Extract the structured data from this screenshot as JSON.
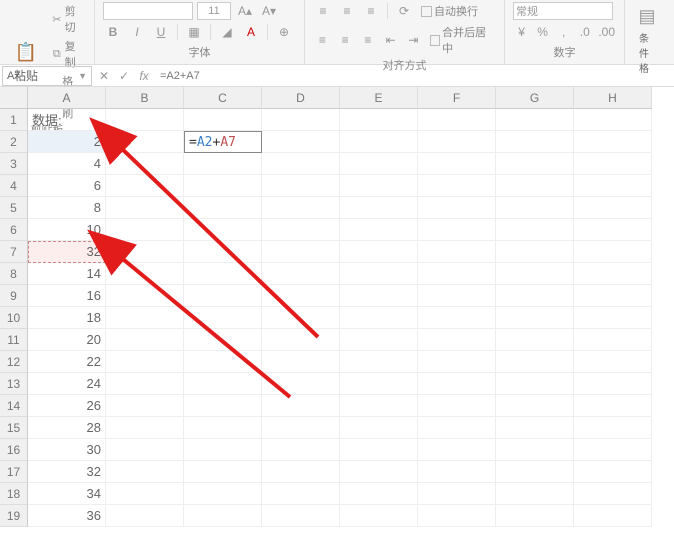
{
  "ribbon": {
    "clipboard": {
      "paste": "粘贴",
      "cut": "剪切",
      "copy": "复制",
      "format_painter": "格式刷",
      "label": "剪贴板"
    },
    "font": {
      "name": "",
      "size": "11",
      "bold": "B",
      "italic": "I",
      "underline": "U",
      "label": "字体"
    },
    "align": {
      "wrap": "自动换行",
      "merge": "合并后居中",
      "label": "对齐方式"
    },
    "number": {
      "general": "常规",
      "label": "数字"
    },
    "styles": {
      "cond": "条件格"
    }
  },
  "formula_bar": {
    "name_box": "A7",
    "formula": "=A2+A7"
  },
  "columns": [
    "A",
    "B",
    "C",
    "D",
    "E",
    "F",
    "G",
    "H"
  ],
  "rows": [
    "1",
    "2",
    "3",
    "4",
    "5",
    "6",
    "7",
    "8",
    "9",
    "10",
    "11",
    "12",
    "13",
    "14",
    "15",
    "16",
    "17",
    "18",
    "19"
  ],
  "sheet": {
    "A1": "数据:",
    "A2": "2",
    "A3": "4",
    "A4": "6",
    "A5": "8",
    "A6": "10",
    "A7": "32",
    "A8": "14",
    "A9": "16",
    "A10": "18",
    "A11": "20",
    "A12": "22",
    "A13": "24",
    "A14": "26",
    "A15": "28",
    "A16": "30",
    "A17": "32",
    "A18": "34",
    "A19": "36",
    "C2_formula_eq": "=",
    "C2_formula_r1": "A2",
    "C2_formula_plus": "+",
    "C2_formula_r2": "A7"
  },
  "chart_data": {
    "type": "table",
    "title": "数据:",
    "categories": [
      "A2",
      "A3",
      "A4",
      "A5",
      "A6",
      "A7",
      "A8",
      "A9",
      "A10",
      "A11",
      "A12",
      "A13",
      "A14",
      "A15",
      "A16",
      "A17",
      "A18",
      "A19"
    ],
    "values": [
      2,
      4,
      6,
      8,
      10,
      32,
      14,
      16,
      18,
      20,
      22,
      24,
      26,
      28,
      30,
      32,
      34,
      36
    ],
    "formula": {
      "cell": "C2",
      "expr": "=A2+A7"
    }
  }
}
